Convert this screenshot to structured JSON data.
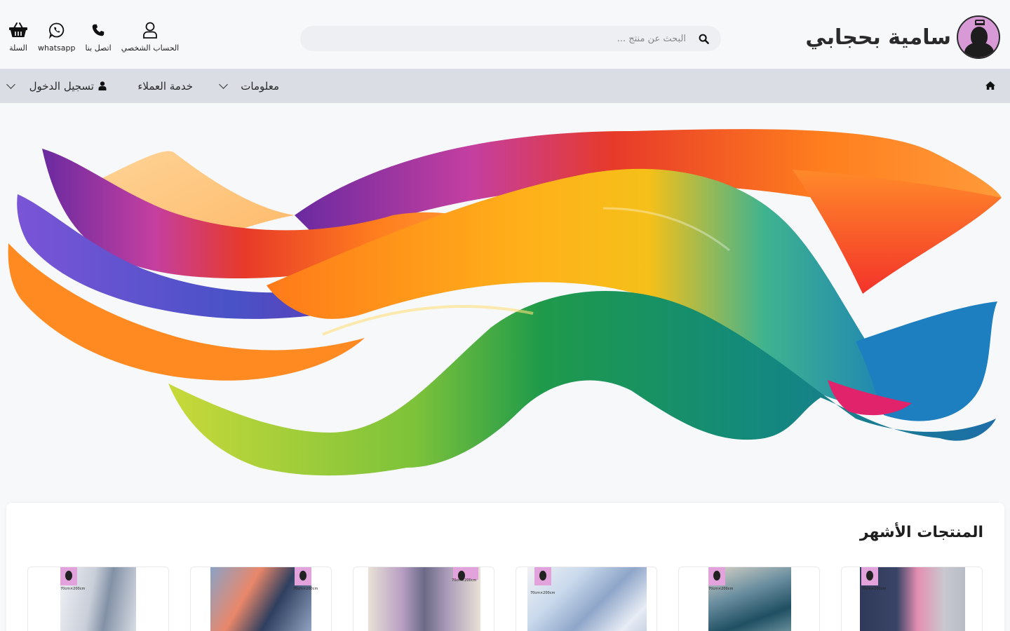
{
  "brand": {
    "name": "سامية بحجابي"
  },
  "search": {
    "placeholder": "البحث عن منتج ..."
  },
  "header_actions": [
    {
      "label": "الحساب الشخصي",
      "icon": "user-icon"
    },
    {
      "label": "اتصل بنا",
      "icon": "phone-icon"
    },
    {
      "label": "whatsapp",
      "icon": "whatsapp-icon"
    },
    {
      "label": "السلة",
      "icon": "basket-icon"
    }
  ],
  "nav": {
    "home_icon": "home-icon",
    "items": [
      {
        "label": "معلومات",
        "dropdown": true
      },
      {
        "label": "خدمة العملاء",
        "dropdown": false
      },
      {
        "label": "تسجيل الدخول",
        "dropdown": true,
        "icon": "user-solid-icon"
      }
    ]
  },
  "hero": {
    "image": "rainbow-silk-scarf-banner"
  },
  "products": {
    "title": "المنتجات الأشهر",
    "items": [
      {
        "size_label": "70cm×200cm",
        "colors": [
          "#2f3a5a",
          "#e58fb2",
          "#c8c8cf"
        ]
      },
      {
        "size_label": "70cm×200cm",
        "colors": [
          "#6b8fa0",
          "#1f4f62",
          "#d9d3c6"
        ]
      },
      {
        "size_label": "70cm×200cm",
        "colors": [
          "#c9d9ec",
          "#8fa6c9",
          "#f1f1f3"
        ]
      },
      {
        "size_label": "70cm×200cm",
        "colors": [
          "#6b6a86",
          "#b89fc4",
          "#e9e1d6"
        ]
      },
      {
        "size_label": "70cm×200cm",
        "colors": [
          "#8aa3c6",
          "#e9876a",
          "#2f3f5f"
        ]
      },
      {
        "size_label": "70cm×200cm",
        "colors": [
          "#c9ced8",
          "#8391a6",
          "#eef0f4"
        ]
      }
    ]
  },
  "colors": {
    "nav_bg": "#dadde3",
    "page_bg": "#f7f8fa",
    "brand_pink": "#d79ad7"
  }
}
